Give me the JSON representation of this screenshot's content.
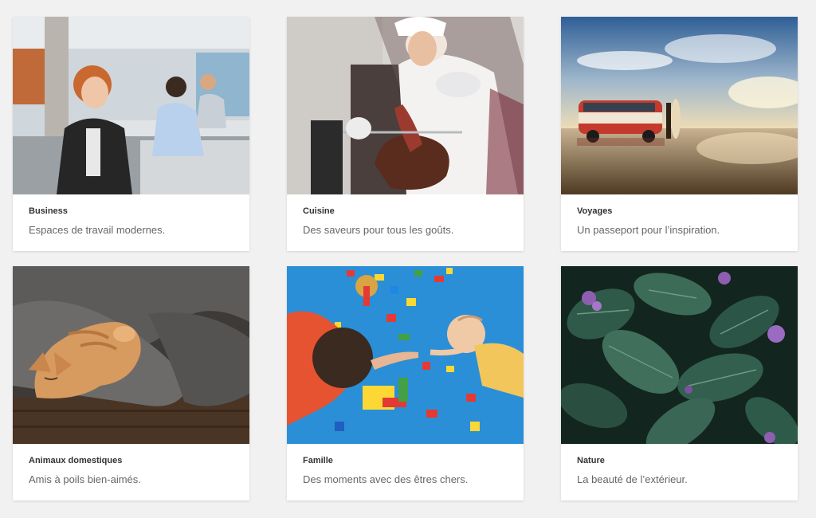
{
  "cards": [
    {
      "title": "Business",
      "description": "Espaces de travail modernes.",
      "image": "office-workers-photo"
    },
    {
      "title": "Cuisine",
      "description": "Des saveurs pour tous les goûts.",
      "image": "chef-slicing-ham-photo"
    },
    {
      "title": "Voyages",
      "description": "Un passeport pour l’inspiration.",
      "image": "van-on-beach-photo"
    },
    {
      "title": "Animaux domestiques",
      "description": "Amis à poils bien-aimés.",
      "image": "kitten-in-blanket-photo"
    },
    {
      "title": "Famille",
      "description": "Des moments avec des êtres chers.",
      "image": "family-playing-blocks-photo"
    },
    {
      "title": "Nature",
      "description": "La beauté de l’extérieur.",
      "image": "green-leaves-flowers-photo"
    }
  ],
  "colors": {
    "background": "#f1f1f1",
    "card": "#ffffff",
    "title": "#333333",
    "description": "#666666"
  }
}
